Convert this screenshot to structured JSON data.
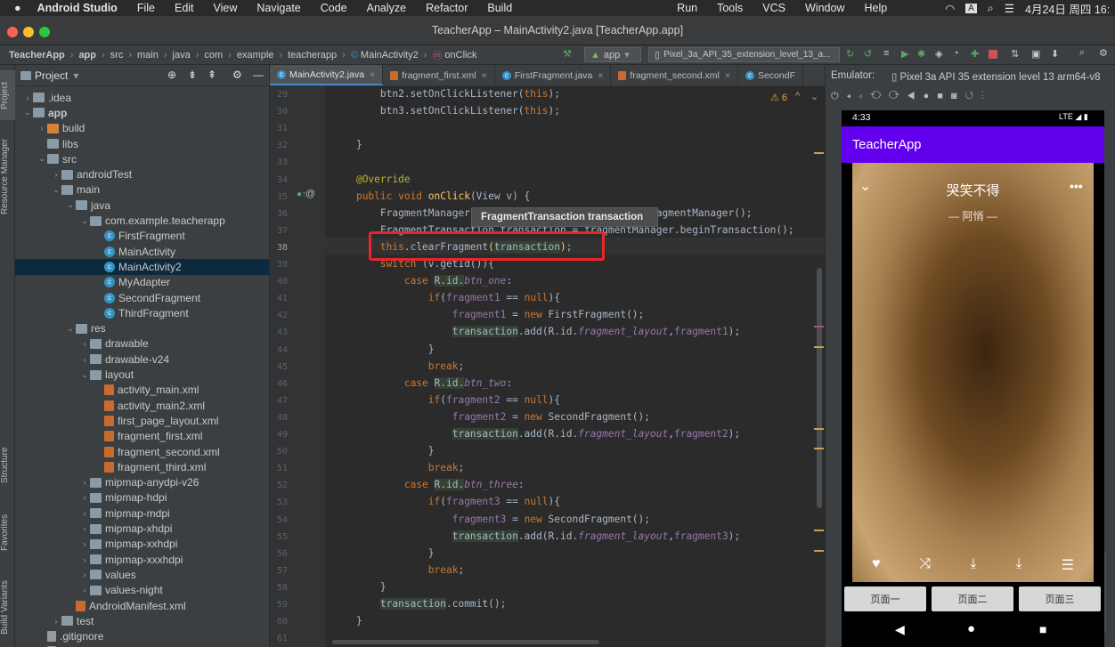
{
  "menubar": {
    "apple": "",
    "app": "Android Studio",
    "items": [
      "File",
      "Edit",
      "View",
      "Navigate",
      "Code",
      "Analyze",
      "Refactor",
      "Build",
      "Run",
      "Tools",
      "VCS",
      "Window",
      "Help"
    ],
    "date": "4月24日 周四 16:"
  },
  "window": {
    "title": "TeacherApp – MainActivity2.java [TeacherApp.app]"
  },
  "breadcrumb": [
    "TeacherApp",
    "app",
    "src",
    "main",
    "java",
    "com",
    "example",
    "teacherapp",
    "MainActivity2",
    "onClick"
  ],
  "toolbar": {
    "run_config": "app",
    "device": "Pixel_3a_API_35_extension_level_13_a..."
  },
  "project_panel": {
    "title": "Project"
  },
  "tree": [
    {
      "label": ".idea",
      "depth": 1,
      "icon": "folder",
      "arrow": "›"
    },
    {
      "label": "app",
      "depth": 1,
      "icon": "folder",
      "arrow": "⌄",
      "bold": true
    },
    {
      "label": "build",
      "depth": 2,
      "icon": "folder-orange",
      "arrow": "›"
    },
    {
      "label": "libs",
      "depth": 2,
      "icon": "folder",
      "arrow": ""
    },
    {
      "label": "src",
      "depth": 2,
      "icon": "folder",
      "arrow": "⌄"
    },
    {
      "label": "androidTest",
      "depth": 3,
      "icon": "folder",
      "arrow": "›"
    },
    {
      "label": "main",
      "depth": 3,
      "icon": "folder",
      "arrow": "⌄"
    },
    {
      "label": "java",
      "depth": 4,
      "icon": "folder",
      "arrow": "⌄"
    },
    {
      "label": "com.example.teacherapp",
      "depth": 5,
      "icon": "folder",
      "arrow": "⌄"
    },
    {
      "label": "FirstFragment",
      "depth": 6,
      "icon": "class",
      "arrow": ""
    },
    {
      "label": "MainActivity",
      "depth": 6,
      "icon": "class",
      "arrow": ""
    },
    {
      "label": "MainActivity2",
      "depth": 6,
      "icon": "class",
      "arrow": "",
      "selected": true
    },
    {
      "label": "MyAdapter",
      "depth": 6,
      "icon": "class",
      "arrow": ""
    },
    {
      "label": "SecondFragment",
      "depth": 6,
      "icon": "class",
      "arrow": ""
    },
    {
      "label": "ThirdFragment",
      "depth": 6,
      "icon": "class",
      "arrow": ""
    },
    {
      "label": "res",
      "depth": 4,
      "icon": "folder",
      "arrow": "⌄"
    },
    {
      "label": "drawable",
      "depth": 5,
      "icon": "folder",
      "arrow": "›"
    },
    {
      "label": "drawable-v24",
      "depth": 5,
      "icon": "folder",
      "arrow": "›"
    },
    {
      "label": "layout",
      "depth": 5,
      "icon": "folder",
      "arrow": "⌄"
    },
    {
      "label": "activity_main.xml",
      "depth": 6,
      "icon": "xml",
      "arrow": ""
    },
    {
      "label": "activity_main2.xml",
      "depth": 6,
      "icon": "xml",
      "arrow": ""
    },
    {
      "label": "first_page_layout.xml",
      "depth": 6,
      "icon": "xml",
      "arrow": ""
    },
    {
      "label": "fragment_first.xml",
      "depth": 6,
      "icon": "xml",
      "arrow": ""
    },
    {
      "label": "fragment_second.xml",
      "depth": 6,
      "icon": "xml",
      "arrow": ""
    },
    {
      "label": "fragment_third.xml",
      "depth": 6,
      "icon": "xml",
      "arrow": ""
    },
    {
      "label": "mipmap-anydpi-v26",
      "depth": 5,
      "icon": "folder",
      "arrow": "›"
    },
    {
      "label": "mipmap-hdpi",
      "depth": 5,
      "icon": "folder",
      "arrow": "›"
    },
    {
      "label": "mipmap-mdpi",
      "depth": 5,
      "icon": "folder",
      "arrow": "›"
    },
    {
      "label": "mipmap-xhdpi",
      "depth": 5,
      "icon": "folder",
      "arrow": "›"
    },
    {
      "label": "mipmap-xxhdpi",
      "depth": 5,
      "icon": "folder",
      "arrow": "›"
    },
    {
      "label": "mipmap-xxxhdpi",
      "depth": 5,
      "icon": "folder",
      "arrow": "›"
    },
    {
      "label": "values",
      "depth": 5,
      "icon": "folder",
      "arrow": "›"
    },
    {
      "label": "values-night",
      "depth": 5,
      "icon": "folder",
      "arrow": "›"
    },
    {
      "label": "AndroidManifest.xml",
      "depth": 4,
      "icon": "xml",
      "arrow": ""
    },
    {
      "label": "test",
      "depth": 3,
      "icon": "folder",
      "arrow": "›"
    },
    {
      "label": ".gitignore",
      "depth": 2,
      "icon": "file",
      "arrow": ""
    },
    {
      "label": "build.gradle",
      "depth": 2,
      "icon": "file",
      "arrow": ""
    }
  ],
  "side_tabs": {
    "project": "Project",
    "resource": "Resource Manager",
    "structure": "Structure",
    "favorites": "Favorites",
    "build_variants": "Build Variants"
  },
  "editor_tabs": [
    "MainActivity2.java",
    "fragment_first.xml",
    "FirstFragment.java",
    "fragment_second.xml",
    "SecondF"
  ],
  "warnings": "⚠ 6",
  "tooltip": "FragmentTransaction transaction",
  "code_lines": [
    {
      "n": 29,
      "html": "        btn2.setOnClickListener(<span class='kw'>this</span>);"
    },
    {
      "n": 30,
      "html": "        btn3.setOnClickListener(<span class='kw'>this</span>);"
    },
    {
      "n": 31,
      "html": ""
    },
    {
      "n": 32,
      "html": "    }"
    },
    {
      "n": 33,
      "html": ""
    },
    {
      "n": 34,
      "html": "    <span class='ann'>@Override</span>"
    },
    {
      "n": 35,
      "html": "    <span class='kw'>public void </span><span class='mt'>onClick</span>(View v) {"
    },
    {
      "n": 36,
      "html": "        FragmentManager fragmentManager = getSupportFragmentManager();"
    },
    {
      "n": 37,
      "html": "        FragmentTransaction transaction = fragmentManager.beginTransaction();"
    },
    {
      "n": 38,
      "html": "        <span class='kw'>this</span>.clearFragment<span class='mt'>(</span><span class='var'>transaction</span><span class='mt'>)</span>;"
    },
    {
      "n": 39,
      "html": "        <span class='kw'>switch </span>(v.getId()){"
    },
    {
      "n": 40,
      "html": "            <span class='kw'>case </span><span class='var'>R.id.</span><span class='fi'>btn_one</span>:"
    },
    {
      "n": 41,
      "html": "                <span class='kw'>if</span>(<span class='fld'>fragment1</span> == <span class='kw'>null</span>){"
    },
    {
      "n": 42,
      "html": "                    <span class='fld'>fragment1</span> = <span class='kw'>new </span>FirstFragment();"
    },
    {
      "n": 43,
      "html": "                    <span class='var'>transaction</span>.add(R.id.<span class='fi'>fragment_layout</span>,<span class='fld'>fragment1</span>);"
    },
    {
      "n": 44,
      "html": "                }"
    },
    {
      "n": 45,
      "html": "                <span class='kw'>break</span>;"
    },
    {
      "n": 46,
      "html": "            <span class='kw'>case </span><span class='var'>R.id.</span><span class='fi'>btn_two</span>:"
    },
    {
      "n": 47,
      "html": "                <span class='kw'>if</span>(<span class='fld'>fragment2</span> == <span class='kw'>null</span>){"
    },
    {
      "n": 48,
      "html": "                    <span class='fld'>fragment2</span> = <span class='kw'>new </span>SecondFragment();"
    },
    {
      "n": 49,
      "html": "                    <span class='var'>transaction</span>.add(R.id.<span class='fi'>fragment_layout</span>,<span class='fld'>fragment2</span>);"
    },
    {
      "n": 50,
      "html": "                }"
    },
    {
      "n": 51,
      "html": "                <span class='kw'>break</span>;"
    },
    {
      "n": 52,
      "html": "            <span class='kw'>case </span><span class='var'>R.id.</span><span class='fi'>btn_three</span>:"
    },
    {
      "n": 53,
      "html": "                <span class='kw'>if</span>(<span class='fld'>fragment3</span> == <span class='kw'>null</span>){"
    },
    {
      "n": 54,
      "html": "                    <span class='fld'>fragment3</span> = <span class='kw'>new </span>SecondFragment();"
    },
    {
      "n": 55,
      "html": "                    <span class='var'>transaction</span>.add(R.id.<span class='fi'>fragment_layout</span>,<span class='fld'>fragment3</span>);"
    },
    {
      "n": 56,
      "html": "                }"
    },
    {
      "n": 57,
      "html": "                <span class='kw'>break</span>;"
    },
    {
      "n": 58,
      "html": "        }"
    },
    {
      "n": 59,
      "html": "        <span class='var'>transaction</span>.commit();"
    },
    {
      "n": 60,
      "html": "    }"
    },
    {
      "n": 61,
      "html": ""
    }
  ],
  "emulator": {
    "label": "Emulator:",
    "device": "Pixel 3a API 35 extension level 13 arm64-v8"
  },
  "phone": {
    "time": "4:33",
    "status": "LTE ◢ ▮",
    "app_title": "TeacherApp",
    "song": "哭笑不得",
    "artist": "阿悄",
    "buttons": [
      "页面一",
      "页面二",
      "页面三"
    ]
  },
  "colors": {
    "accent": "#4a88c7",
    "purple": "#6200ee",
    "highlight_box": "#e8262c"
  }
}
